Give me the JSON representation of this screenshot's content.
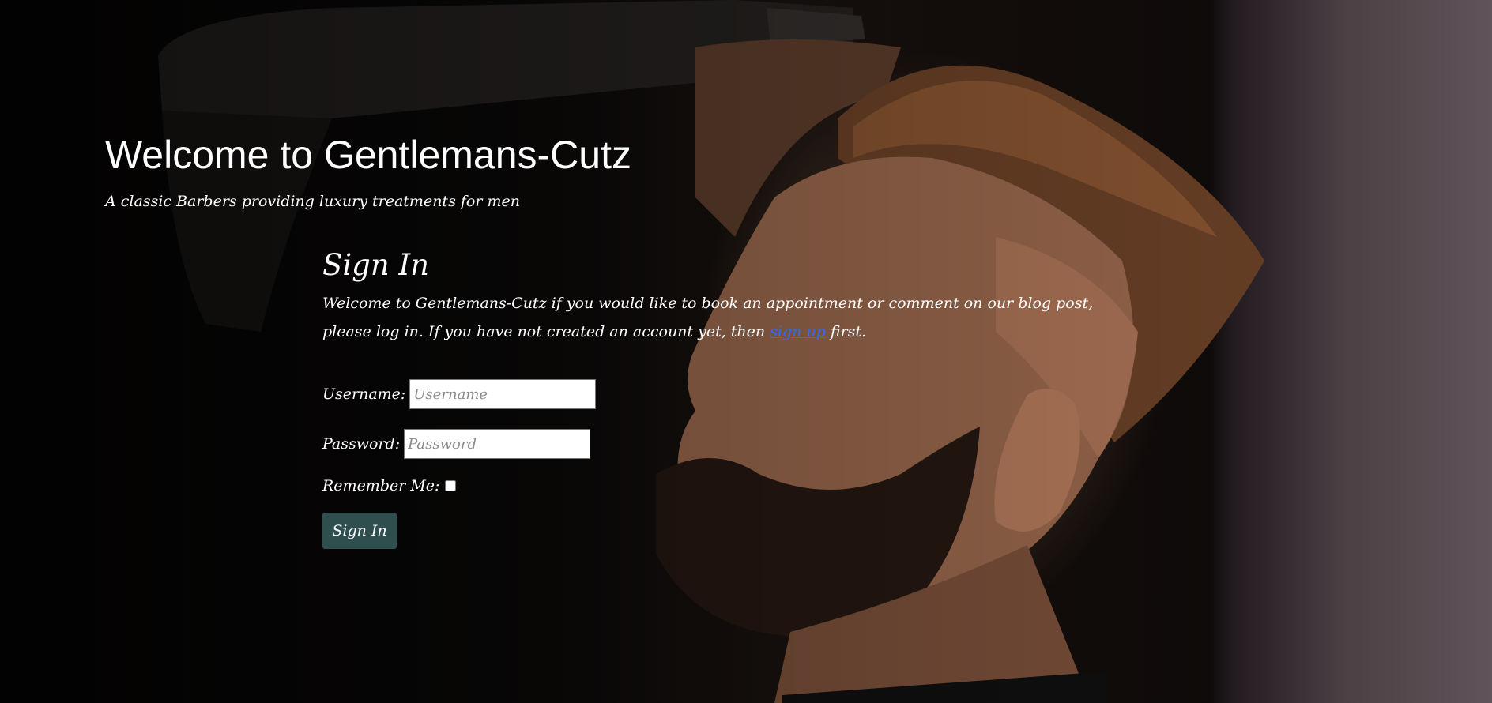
{
  "header": {
    "title": "Welcome to Gentlemans-Cutz",
    "tagline": "A classic Barbers providing luxury treatments for men"
  },
  "signin": {
    "heading": "Sign In",
    "intro_before": "Welcome to Gentlemans-Cutz if you would like to book an appointment or comment on our blog post, please log in. If you have not created an account yet, then ",
    "signup_link": "sign up",
    "intro_after": " first.",
    "username_label": "Username:",
    "username_placeholder": "Username",
    "username_value": "",
    "password_label": "Password:",
    "password_placeholder": "Password",
    "password_value": "",
    "remember_label": "Remember Me:",
    "remember_checked": false,
    "submit_label": "Sign In"
  },
  "colors": {
    "button_bg": "#2f4f4f",
    "link": "#2f6bff",
    "text": "#ffffff"
  },
  "icons": {
    "background": "barber-photo-background"
  }
}
